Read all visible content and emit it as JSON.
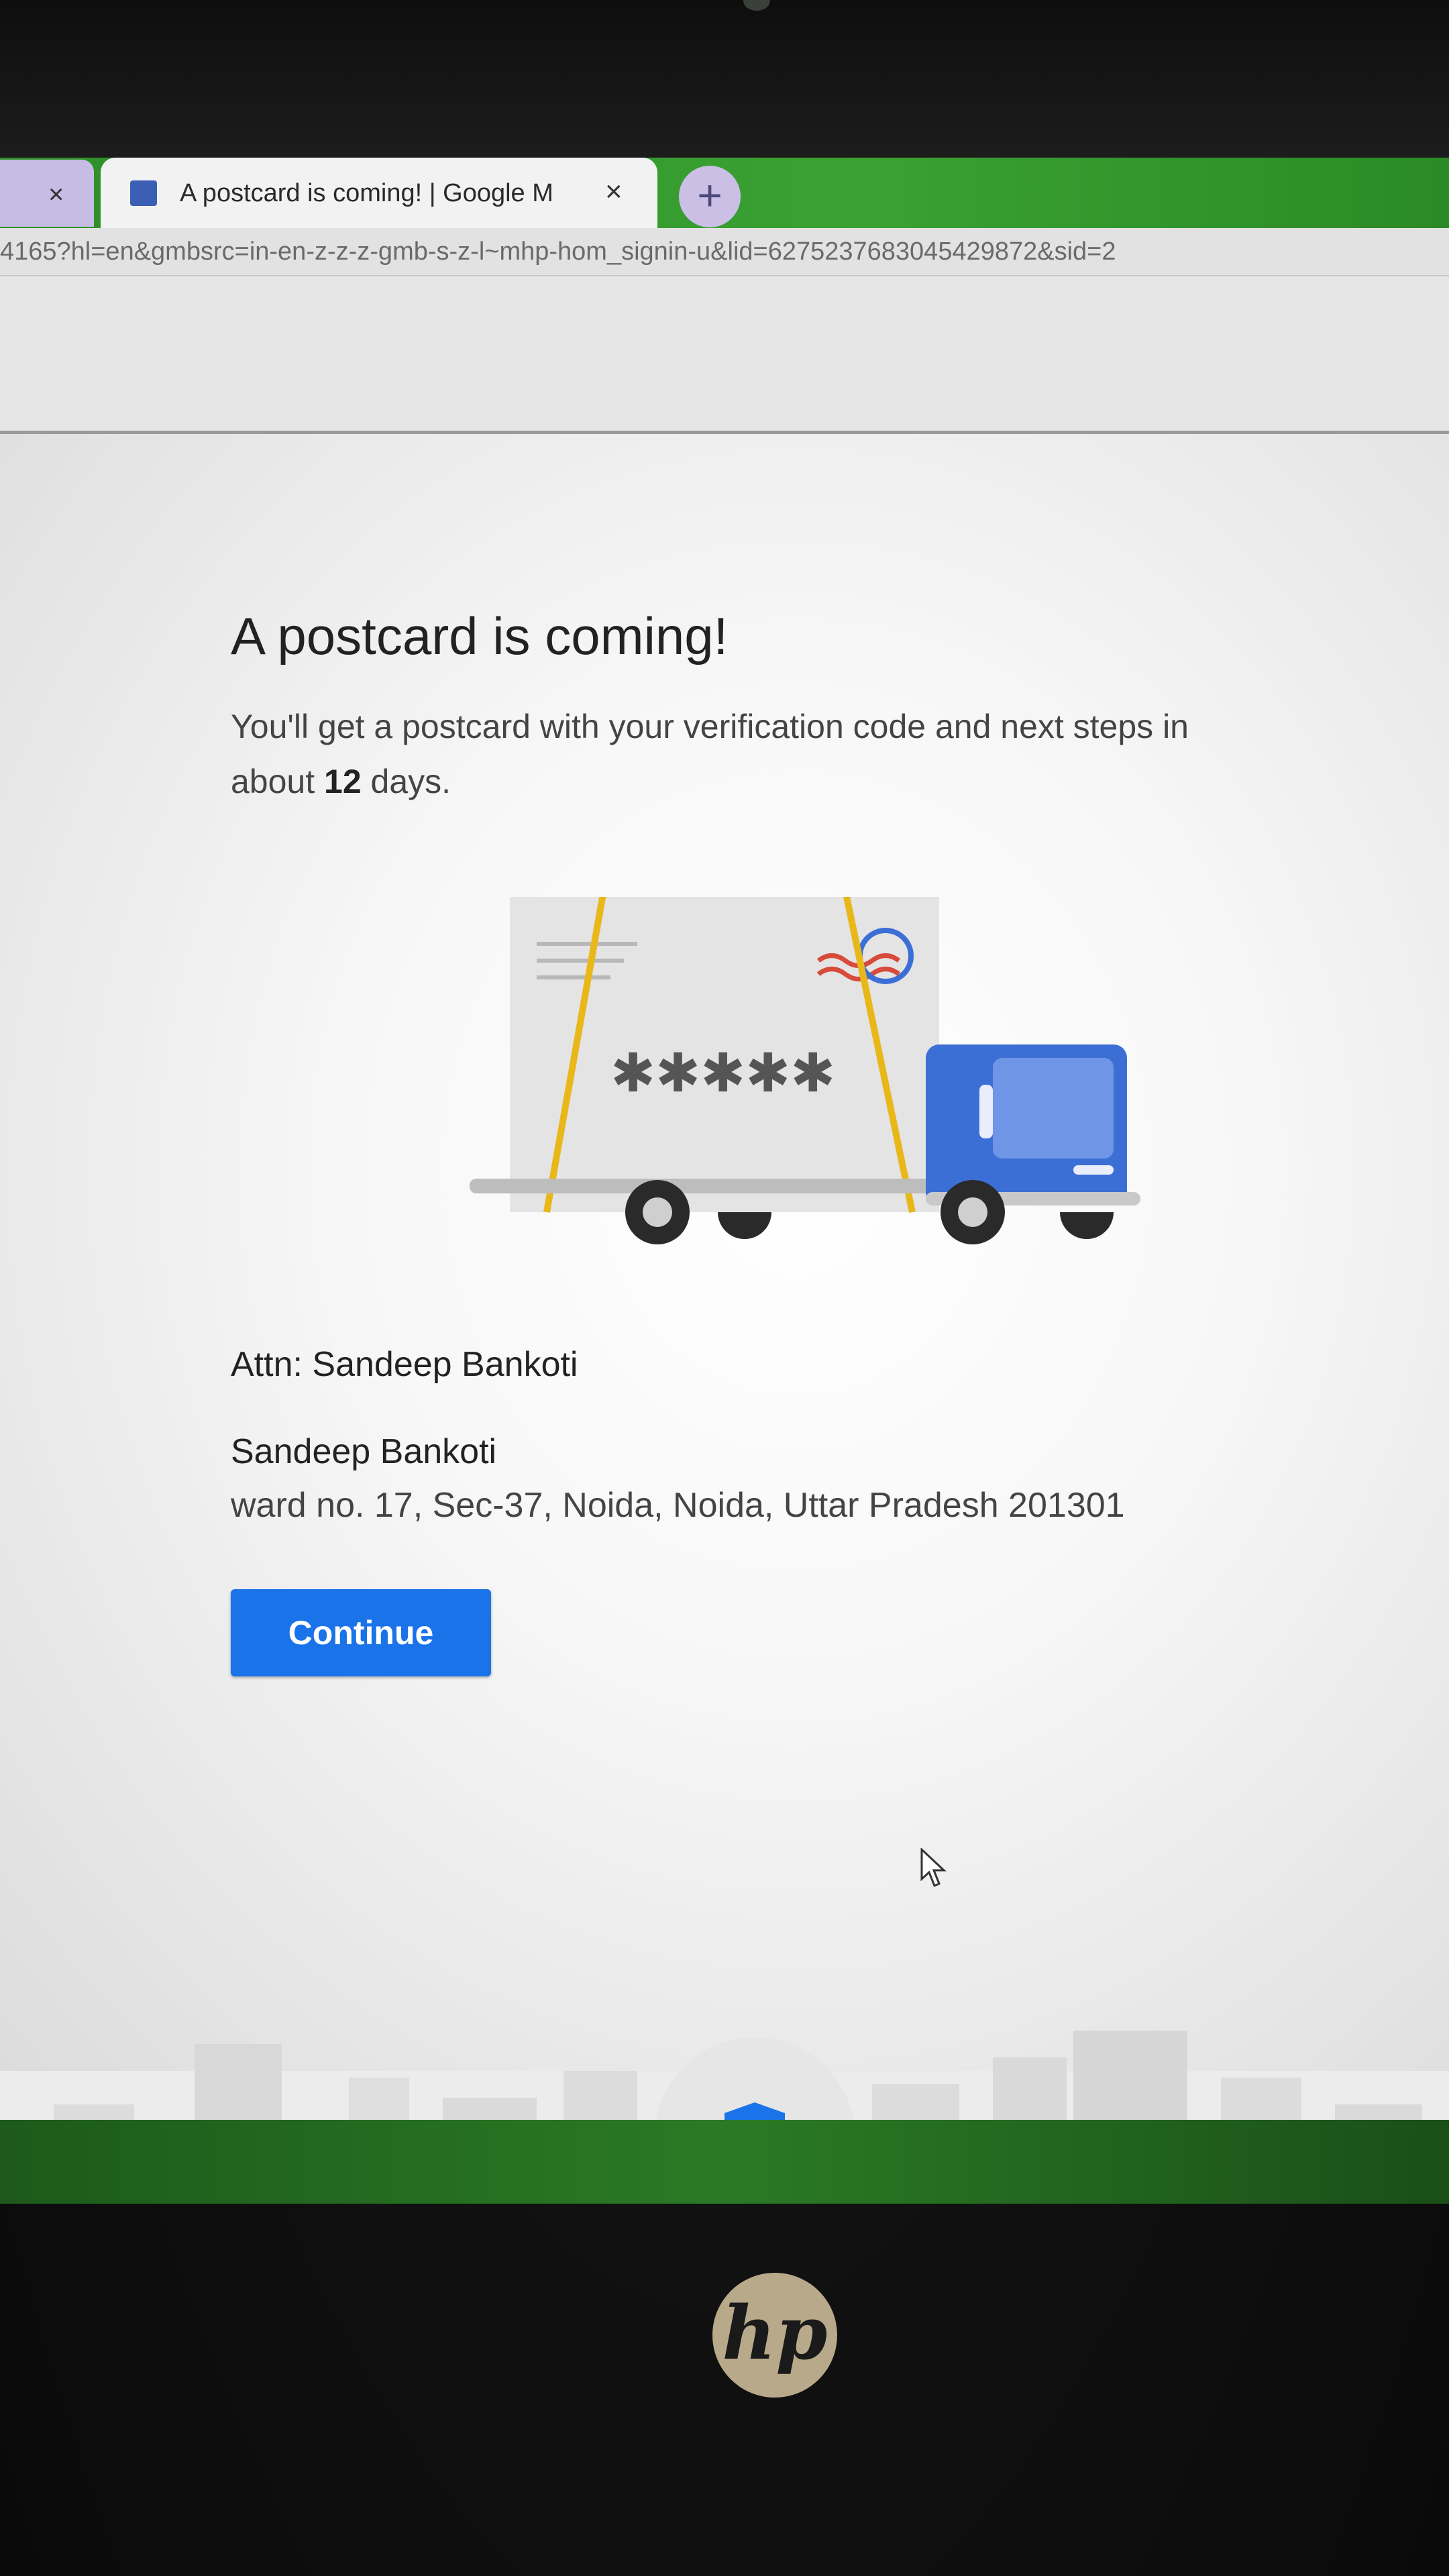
{
  "browser": {
    "tabs": [
      {
        "label": "",
        "close_glyph": "×"
      },
      {
        "label": "A postcard is coming! | Google M",
        "close_glyph": "×"
      }
    ],
    "new_tab_glyph": "+",
    "url": "4165?hl=en&gmbsrc=in-en-z-z-z-gmb-s-z-l~mhp-hom_signin-u&lid=6275237683045429872&sid=2"
  },
  "page": {
    "heading": "A postcard is coming!",
    "subtext_before": "You'll get a postcard with your verification code and next steps in about ",
    "subtext_days": "12",
    "subtext_after": " days.",
    "illustration": {
      "code_mask": "✱✱✱✱✱"
    },
    "attn": "Attn: Sandeep Bankoti",
    "recipient_name": "Sandeep Bankoti",
    "address": "ward no. 17, Sec-37, Noida, Noida, Uttar Pradesh 201301",
    "continue_label": "Continue"
  },
  "device": {
    "brand_logo": "hp"
  },
  "colors": {
    "primary_button": "#1a73e8",
    "truck_cab": "#3c6fd6",
    "truck_straps": "#e8b81a",
    "taskbar": "#2a7a25"
  },
  "icons": {
    "favicon": "google-my-business-icon",
    "shield": "verified-shield-icon",
    "cursor": "mouse-pointer-icon"
  }
}
